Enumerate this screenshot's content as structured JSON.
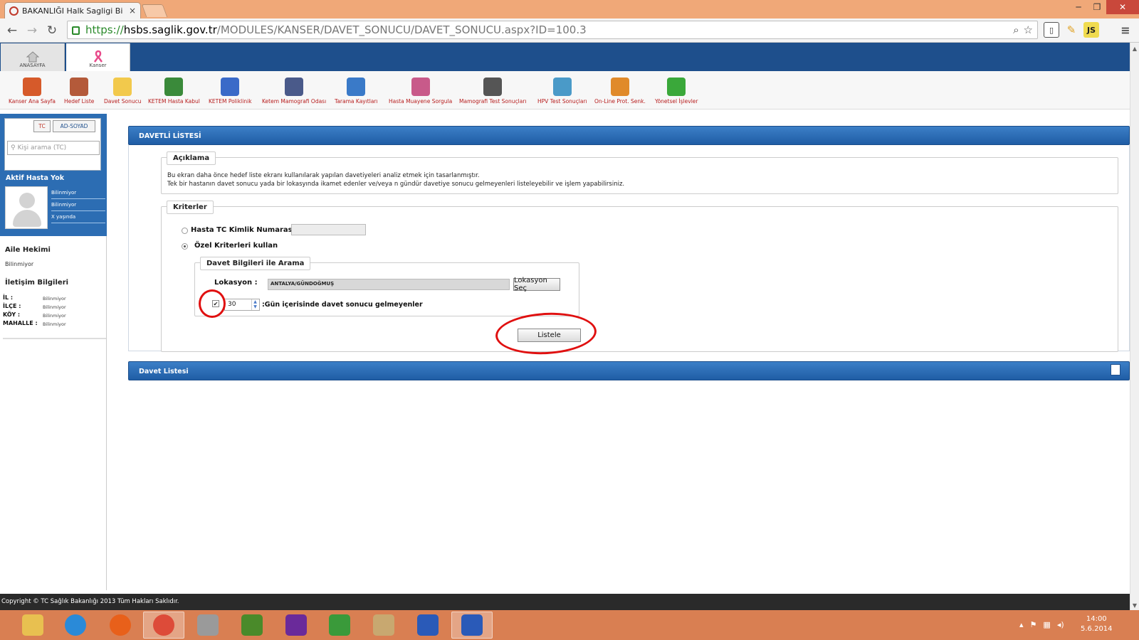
{
  "browser": {
    "tab_title": "BAKANLIĞI Halk Sagligi Bi",
    "tab_close": "×",
    "url_scheme": "https://",
    "url_host": "hsbs.saglik.gov.tr",
    "url_path": "/MODULES/KANSER/DAVET_SONUCU/DAVET_SONUCU.aspx?ID=100.3",
    "window_controls": [
      "─",
      "❐",
      "✕"
    ],
    "nav": {
      "back": "←",
      "forward": "→",
      "reload": "↻"
    },
    "extensions": [
      {
        "icon": "extension-bookmark-icon",
        "color": "#555555",
        "text": "▯"
      },
      {
        "icon": "extension-pencil-icon",
        "color": "#e0a020",
        "text": "✎"
      },
      {
        "icon": "extension-js-icon",
        "color": "#f0db4f",
        "text": "JS"
      },
      {
        "icon": "chrome-menu-icon",
        "color": "#555555",
        "text": "≡"
      }
    ]
  },
  "app": {
    "top_tabs": [
      {
        "label": "ANASAYFA",
        "icon": "home-icon",
        "active": false
      },
      {
        "label": "Kanser",
        "icon": "pink-ribbon-icon",
        "active": true
      }
    ],
    "modules": [
      {
        "label": "Kanser Ana Sayfa",
        "icon": "house-icon",
        "color": "#d65a2a"
      },
      {
        "label": "Hedef Liste",
        "icon": "clipboard-icon",
        "color": "#b45a3a"
      },
      {
        "label": "Davet Sonucu",
        "icon": "envelope-icon",
        "color": "#f2c94c"
      },
      {
        "label": "KETEM Hasta Kabul",
        "icon": "user-add-icon",
        "color": "#3a8a3a"
      },
      {
        "label": "KETEM Poliklinik",
        "icon": "stethoscope-icon",
        "color": "#3a6ac8"
      },
      {
        "label": "Ketem Mamografi Odası",
        "icon": "monitor-icon",
        "color": "#4a5a8a"
      },
      {
        "label": "Tarama Kayıtları",
        "icon": "edit-list-icon",
        "color": "#3a7ac8"
      },
      {
        "label": "Hasta Muayene Sorgula",
        "icon": "doctor-icon",
        "color": "#c85a8a"
      },
      {
        "label": "Mamografi Test Sonuçları",
        "icon": "xray-icon",
        "color": "#555555"
      },
      {
        "label": "HPV Test Sonuçları",
        "icon": "flask-icon",
        "color": "#4a9ac8"
      },
      {
        "label": "On-Line Prot. Senk.",
        "icon": "sync-arrows-icon",
        "color": "#e08a2a"
      },
      {
        "label": "Yönetsel İşlevler",
        "icon": "pie-chart-icon",
        "color": "#3aa83a"
      }
    ]
  },
  "sidebar": {
    "search_tabs": [
      "TC",
      "AD-SOYAD"
    ],
    "search_placeholder": "Kişi arama (TC)",
    "active_patient": "Aktif Hasta Yok",
    "patient_info": [
      "Bilinmiyor",
      "Bilinmiyor",
      "X yaşında"
    ],
    "family_doctor_title": "Aile Hekimi",
    "family_doctor_value": "Bilinmiyor",
    "contact_title": "İletişim Bilgileri",
    "contact": [
      {
        "key": "İL :",
        "value": "Bilinmiyor"
      },
      {
        "key": "İLÇE :",
        "value": "Bilinmiyor"
      },
      {
        "key": "KÖY :",
        "value": "Bilinmiyor"
      },
      {
        "key": "MAHALLE :",
        "value": "Bilinmiyor"
      }
    ]
  },
  "main": {
    "header": "DAVETLİ LİSTESİ",
    "aciklama": {
      "legend": "Açıklama",
      "line1": "Bu ekran daha önce hedef liste ekranı kullanılarak yapılan davetiyeleri analiz etmek için tasarlanmıştır.",
      "line2": "Tek bir hastanın davet sonucu yada bir lokasyında ikamet edenler ve/veya n gündür davetiye sonucu gelmeyenleri listeleyebilir ve işlem yapabilirsiniz."
    },
    "kriterler": {
      "legend": "Kriterler",
      "radio_tc_label": "Hasta TC Kimlik Numarası",
      "radio_ozel_label": "Özel Kriterleri kullan",
      "tc_value": "",
      "davet": {
        "legend": "Davet Bilgileri ile Arama",
        "lokasyon_label": "Lokasyon :",
        "lokasyon_value": "ANTALYA/GÜNDOĞMUŞ",
        "lokasyon_button": "Lokasyon Seç",
        "days_checked": "✔",
        "days_value": "30",
        "days_label": ":Gün içerisinde davet sonucu gelmeyenler"
      },
      "listele_button": "Listele"
    },
    "davet_listesi_header": "Davet Listesi"
  },
  "footer": {
    "text": "Copyright © TC Sağlık Bakanlığı 2013 Tüm Hakları Saklıdır."
  },
  "taskbar": {
    "apps": [
      {
        "icon": "file-explorer-icon",
        "color": "#e8c050"
      },
      {
        "icon": "internet-explorer-icon",
        "color": "#2a8ad8"
      },
      {
        "icon": "firefox-icon",
        "color": "#e8601a"
      },
      {
        "icon": "chrome-icon",
        "color": "#dd4b39"
      },
      {
        "icon": "snipping-tool-icon",
        "color": "#9a9a9a"
      },
      {
        "icon": "frog-app-icon",
        "color": "#4a8a2a"
      },
      {
        "icon": "visual-studio-icon",
        "color": "#6a2a9a"
      },
      {
        "icon": "chart-app-icon",
        "color": "#3a9a3a"
      },
      {
        "icon": "paint-icon",
        "color": "#c8a870"
      },
      {
        "icon": "remote-desktop-icon",
        "color": "#2a5ab8"
      },
      {
        "icon": "word-icon",
        "color": "#2a5ab8"
      }
    ],
    "time": "14:00",
    "date": "5.6.2014"
  }
}
